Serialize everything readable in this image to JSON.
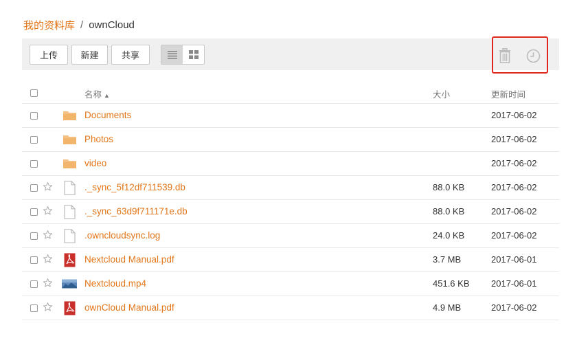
{
  "breadcrumb": {
    "root": "我的资料库",
    "separator": "/",
    "current": "ownCloud"
  },
  "toolbar": {
    "upload_label": "上传",
    "new_label": "新建",
    "share_label": "共享",
    "list_view_icon": "list-view-icon",
    "grid_view_icon": "grid-view-icon",
    "trash_icon": "trash-icon",
    "history_icon": "history-icon"
  },
  "table": {
    "headers": {
      "name": "名称",
      "sort_indicator": "▲",
      "size": "大小",
      "modified": "更新时间"
    },
    "rows": [
      {
        "name": "Documents",
        "size": "",
        "date": "2017-06-02",
        "type": "folder",
        "star": false
      },
      {
        "name": "Photos",
        "size": "",
        "date": "2017-06-02",
        "type": "folder",
        "star": false
      },
      {
        "name": "video",
        "size": "",
        "date": "2017-06-02",
        "type": "folder",
        "star": false
      },
      {
        "name": "._sync_5f12df711539.db",
        "size": "88.0 KB",
        "date": "2017-06-02",
        "type": "file",
        "star": true
      },
      {
        "name": "._sync_63d9f711171e.db",
        "size": "88.0 KB",
        "date": "2017-06-02",
        "type": "file",
        "star": true
      },
      {
        "name": ".owncloudsync.log",
        "size": "24.0 KB",
        "date": "2017-06-02",
        "type": "file",
        "star": true
      },
      {
        "name": "Nextcloud Manual.pdf",
        "size": "3.7 MB",
        "date": "2017-06-01",
        "type": "pdf",
        "star": true
      },
      {
        "name": "Nextcloud.mp4",
        "size": "451.6 KB",
        "date": "2017-06-01",
        "type": "video",
        "star": true
      },
      {
        "name": "ownCloud Manual.pdf",
        "size": "4.9 MB",
        "date": "2017-06-02",
        "type": "pdf",
        "star": true
      }
    ]
  },
  "colors": {
    "accent": "#e2761a",
    "highlight": "#e0261c",
    "toolbar_bg": "#f0f0f0",
    "folder": "#f3b46b",
    "pdf": "#c9302c"
  }
}
